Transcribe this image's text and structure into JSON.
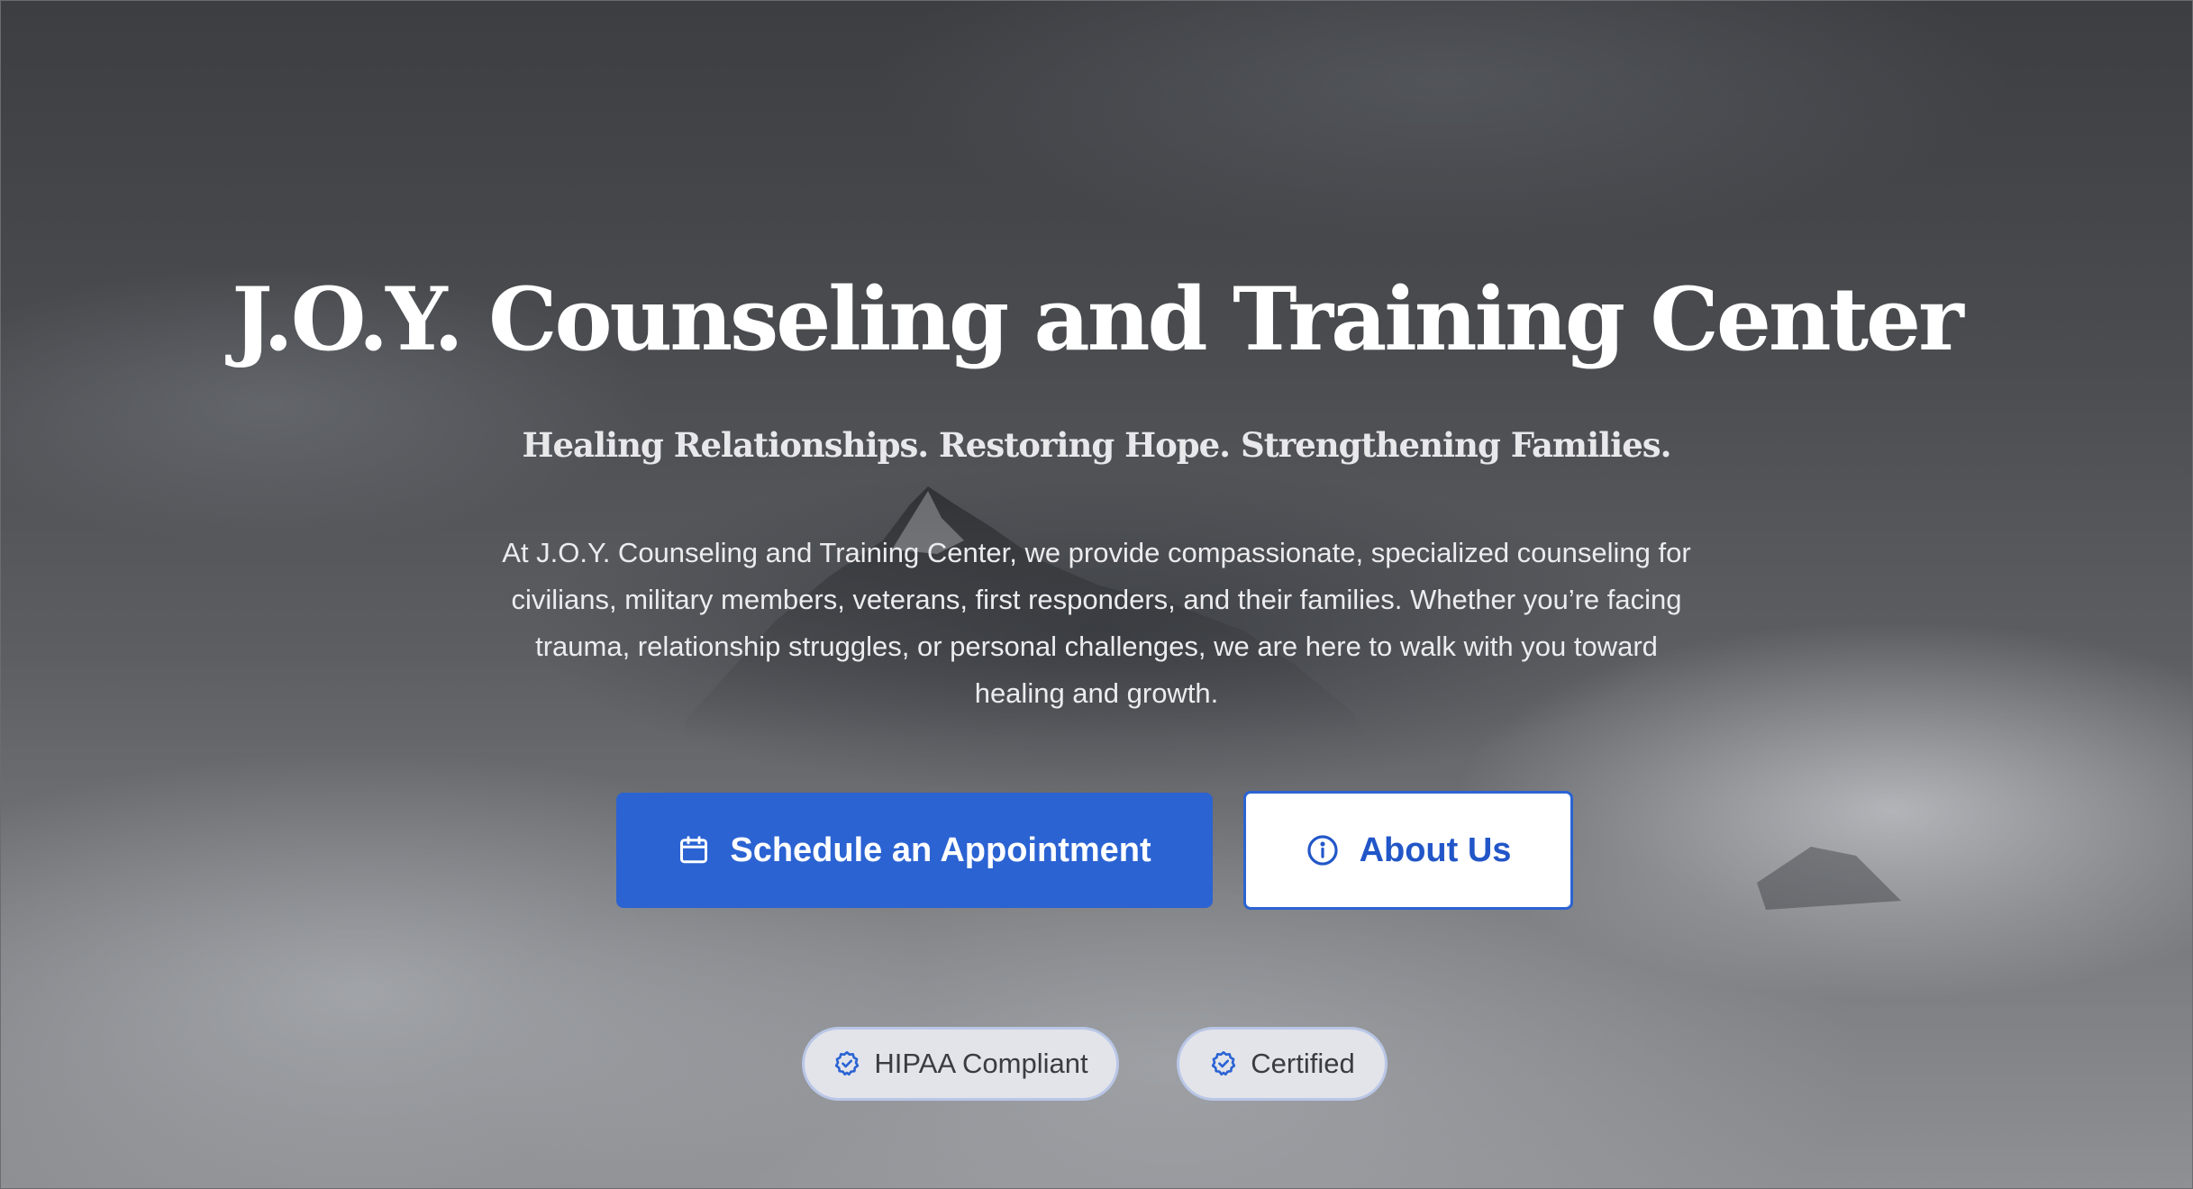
{
  "hero": {
    "title": "J.O.Y. Counseling and Training Center",
    "tagline": "Healing Relationships. Restoring Hope. Strengthening Families.",
    "description": "At J.O.Y. Counseling and Training Center, we provide compassionate, specialized counseling for civilians, military members, veterans, first responders, and their families. Whether you’re facing trauma, relationship struggles, or personal challenges, we are here to walk with you toward healing and growth."
  },
  "buttons": {
    "schedule_label": "Schedule an Appointment",
    "schedule_icon": "calendar-icon",
    "about_label": "About Us",
    "about_icon": "info-icon"
  },
  "badges": [
    {
      "label": "HIPAA Compliant",
      "icon": "shield-check-icon"
    },
    {
      "label": "Certified",
      "icon": "shield-check-icon"
    }
  ],
  "colors": {
    "primary": "#2b63d3",
    "primary_text": "#ffffff",
    "secondary_bg": "#ffffff",
    "secondary_text": "#2256c8",
    "badge_bg": "#e2e4ea",
    "badge_border": "#b9c6e6"
  }
}
